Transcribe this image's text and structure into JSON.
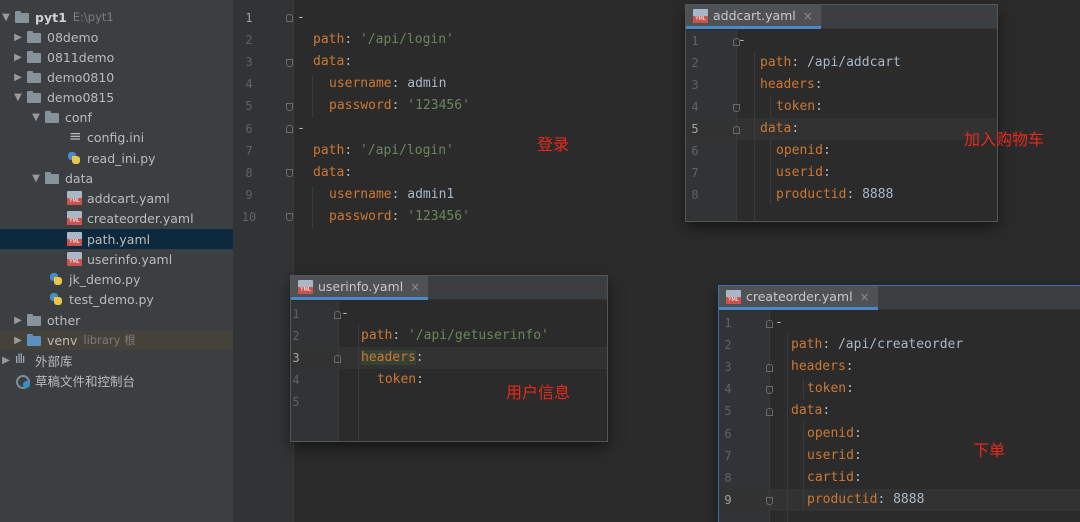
{
  "project_tree": {
    "items": [
      {
        "label": "pyt1",
        "path": "E:\\pyt1",
        "icon": "folder-icon"
      },
      {
        "label": "08demo",
        "icon": "folder-icon"
      },
      {
        "label": "0811demo",
        "icon": "folder-icon"
      },
      {
        "label": "demo0810",
        "icon": "folder-icon"
      },
      {
        "label": "demo0815",
        "icon": "folder-icon"
      },
      {
        "label": "conf",
        "icon": "folder-icon"
      },
      {
        "label": "config.ini",
        "icon": "ini-file-icon"
      },
      {
        "label": "read_ini.py",
        "icon": "python-file-icon"
      },
      {
        "label": "data",
        "icon": "folder-icon"
      },
      {
        "label": "addcart.yaml",
        "icon": "yaml-file-icon"
      },
      {
        "label": "createorder.yaml",
        "icon": "yaml-file-icon"
      },
      {
        "label": "path.yaml",
        "icon": "yaml-file-icon"
      },
      {
        "label": "userinfo.yaml",
        "icon": "yaml-file-icon"
      },
      {
        "label": "jk_demo.py",
        "icon": "python-file-icon"
      },
      {
        "label": "test_demo.py",
        "icon": "python-file-icon"
      },
      {
        "label": "other",
        "icon": "folder-icon"
      },
      {
        "label": "venv",
        "suffix": "library 根",
        "icon": "folder-icon"
      },
      {
        "label": "外部库",
        "icon": "library-icon"
      },
      {
        "label": "草稿文件和控制台",
        "icon": "scratch-icon"
      }
    ]
  },
  "editor": {
    "file": "path.yaml",
    "line_numbers": [
      "1",
      "2",
      "3",
      "4",
      "5",
      "6",
      "7",
      "8",
      "9",
      "10"
    ],
    "lines": [
      {
        "dash": "-"
      },
      {
        "key": "path",
        "value": "'/api/login'"
      },
      {
        "key": "data"
      },
      {
        "key": "username",
        "value": "admin"
      },
      {
        "key": "password",
        "value": "'123456'"
      },
      {
        "dash": "-"
      },
      {
        "key": "path",
        "value": "'/api/login'"
      },
      {
        "key": "data"
      },
      {
        "key": "username",
        "value": "admin1"
      },
      {
        "key": "password",
        "value": "'123456'"
      }
    ]
  },
  "addcart_window": {
    "tab_label": "addcart.yaml",
    "close": "×",
    "line_numbers": [
      "1",
      "2",
      "3",
      "4",
      "5",
      "6",
      "7",
      "8"
    ],
    "lines": [
      {
        "dash": "-"
      },
      {
        "key": "path",
        "value": "/api/addcart"
      },
      {
        "key": "headers"
      },
      {
        "key": "token"
      },
      {
        "key": "data"
      },
      {
        "key": "openid"
      },
      {
        "key": "userid"
      },
      {
        "key": "productid",
        "value": "8888"
      }
    ]
  },
  "userinfo_window": {
    "tab_label": "userinfo.yaml",
    "close": "×",
    "line_numbers": [
      "1",
      "2",
      "3",
      "4",
      "5"
    ],
    "lines": [
      {
        "dash": "-"
      },
      {
        "key": "path",
        "value": "'/api/getuserinfo'"
      },
      {
        "key": "headers"
      },
      {
        "key": "token"
      }
    ]
  },
  "createorder_window": {
    "tab_label": "createorder.yaml",
    "close": "×",
    "line_numbers": [
      "1",
      "2",
      "3",
      "4",
      "5",
      "6",
      "7",
      "8",
      "9"
    ],
    "lines": [
      {
        "dash": "-"
      },
      {
        "key": "path",
        "value": "/api/createorder"
      },
      {
        "key": "headers"
      },
      {
        "key": "token"
      },
      {
        "key": "data"
      },
      {
        "key": "openid"
      },
      {
        "key": "userid"
      },
      {
        "key": "cartid"
      },
      {
        "key": "productid",
        "value": "8888"
      }
    ]
  },
  "annotations": {
    "login": "登录",
    "add_to_cart": "加入购物车",
    "user_info": "用户信息",
    "create_order": "下单"
  },
  "colors": {
    "key": "#cc7832",
    "string": "#6a8759",
    "text": "#a9b7c6",
    "annotation": "#e8291c",
    "selection": "#0d293e"
  }
}
